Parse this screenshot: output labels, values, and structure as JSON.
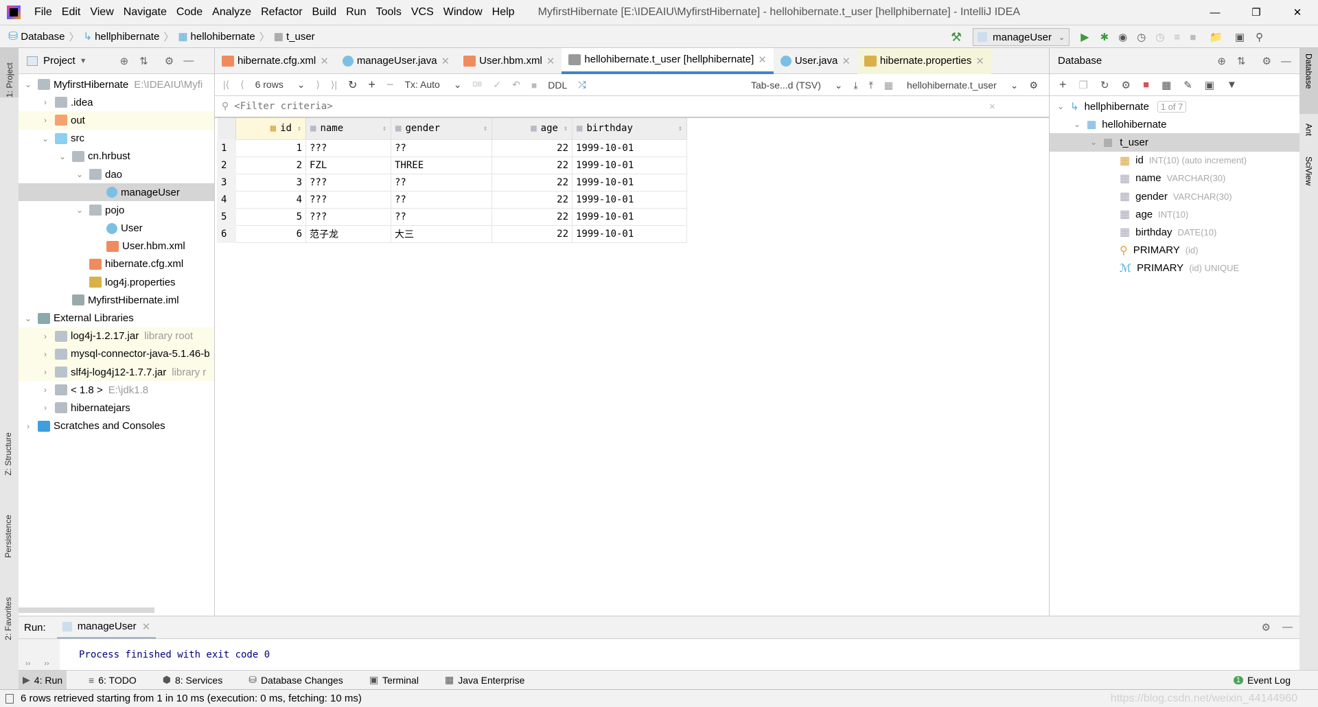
{
  "title": "MyfirstHibernate [E:\\IDEAIU\\MyfirstHibernate] - hellohibernate.t_user [hellphibernate] - IntelliJ IDEA",
  "menu": [
    "File",
    "Edit",
    "View",
    "Navigate",
    "Code",
    "Analyze",
    "Refactor",
    "Build",
    "Run",
    "Tools",
    "VCS",
    "Window",
    "Help"
  ],
  "breadcrumb": [
    "Database",
    "hellphibernate",
    "hellohibernate",
    "t_user"
  ],
  "run_config": "manageUser",
  "left_stripe": {
    "project": "1: Project",
    "structure": "Z: Structure",
    "persistence": "Persistence",
    "favorites": "2: Favorites"
  },
  "right_stripe": {
    "database": "Database",
    "ant": "Ant",
    "sciview": "SciView"
  },
  "project": {
    "header": "Project",
    "items": [
      {
        "label": "MyfirstHibernate",
        "hint": "E:\\IDEAIU\\Myfi",
        "level": 0,
        "open": "v"
      },
      {
        "label": ".idea",
        "level": 1,
        "open": ">"
      },
      {
        "label": "out",
        "level": 1,
        "open": ">"
      },
      {
        "label": "src",
        "level": 1,
        "open": "v"
      },
      {
        "label": "cn.hrbust",
        "level": 2,
        "open": "v"
      },
      {
        "label": "dao",
        "level": 3,
        "open": "v"
      },
      {
        "label": "manageUser",
        "level": 4,
        "open": ""
      },
      {
        "label": "pojo",
        "level": 3,
        "open": "v"
      },
      {
        "label": "User",
        "level": 4,
        "open": ""
      },
      {
        "label": "User.hbm.xml",
        "level": 4,
        "open": ""
      },
      {
        "label": "hibernate.cfg.xml",
        "level": 3,
        "open": ""
      },
      {
        "label": "log4j.properties",
        "level": 3,
        "open": ""
      },
      {
        "label": "MyfirstHibernate.iml",
        "level": 2,
        "open": ""
      },
      {
        "label": "External Libraries",
        "level": 0,
        "open": "v"
      },
      {
        "label": "log4j-1.2.17.jar",
        "hint": "library root",
        "level": 1,
        "open": ">"
      },
      {
        "label": "mysql-connector-java-5.1.46-b",
        "level": 1,
        "open": ">"
      },
      {
        "label": "slf4j-log4j12-1.7.7.jar",
        "hint": "library r",
        "level": 1,
        "open": ">"
      },
      {
        "label": "< 1.8 >",
        "hint": "E:\\jdk1.8",
        "level": 1,
        "open": ">"
      },
      {
        "label": "hibernatejars",
        "level": 1,
        "open": ">"
      },
      {
        "label": "Scratches and Consoles",
        "level": 0,
        "open": ">"
      }
    ]
  },
  "tabs": [
    {
      "label": "hibernate.cfg.xml"
    },
    {
      "label": "manageUser.java"
    },
    {
      "label": "User.hbm.xml"
    },
    {
      "label": "hellohibernate.t_user [hellphibernate]"
    },
    {
      "label": "User.java"
    },
    {
      "label": "hibernate.properties"
    }
  ],
  "toolbar": {
    "rows": "6 rows",
    "tx": "Tx: Auto",
    "ddl": "DDL",
    "format": "Tab-se...d (TSV)",
    "target": "hellohibernate.t_user"
  },
  "filter_placeholder": "<Filter criteria>",
  "table": {
    "columns": [
      "id",
      "name",
      "gender",
      "age",
      "birthday"
    ],
    "rows": [
      [
        "1",
        "1",
        "???",
        "??",
        "22",
        "1999-10-01"
      ],
      [
        "2",
        "2",
        "FZL",
        "THREE",
        "22",
        "1999-10-01"
      ],
      [
        "3",
        "3",
        "???",
        "??",
        "22",
        "1999-10-01"
      ],
      [
        "4",
        "4",
        "???",
        "??",
        "22",
        "1999-10-01"
      ],
      [
        "5",
        "5",
        "???",
        "??",
        "22",
        "1999-10-01"
      ],
      [
        "6",
        "6",
        "范子龙",
        "大三",
        "22",
        "1999-10-01"
      ]
    ]
  },
  "database": {
    "header": "Database",
    "datasource": "hellphibernate",
    "count": "1 of 7",
    "schema": "hellohibernate",
    "table": "t_user",
    "columns": [
      {
        "name": "id",
        "type": "INT(10) (auto increment)"
      },
      {
        "name": "name",
        "type": "VARCHAR(30)"
      },
      {
        "name": "gender",
        "type": "VARCHAR(30)"
      },
      {
        "name": "age",
        "type": "INT(10)"
      },
      {
        "name": "birthday",
        "type": "DATE(10)"
      },
      {
        "name": "PRIMARY",
        "type": "(id)"
      },
      {
        "name": "PRIMARY",
        "type": "(id) UNIQUE"
      }
    ]
  },
  "run": {
    "label": "Run:",
    "tab": "manageUser",
    "output": "Process finished with exit code 0"
  },
  "bottom_tabs": [
    "4: Run",
    "6: TODO",
    "8: Services",
    "Database Changes",
    "Terminal",
    "Java Enterprise"
  ],
  "event_log": {
    "count": "1",
    "label": "Event Log"
  },
  "status": "6 rows retrieved starting from 1 in 10 ms (execution: 0 ms, fetching: 10 ms)",
  "watermark": "https://blog.csdn.net/weixin_44144960"
}
